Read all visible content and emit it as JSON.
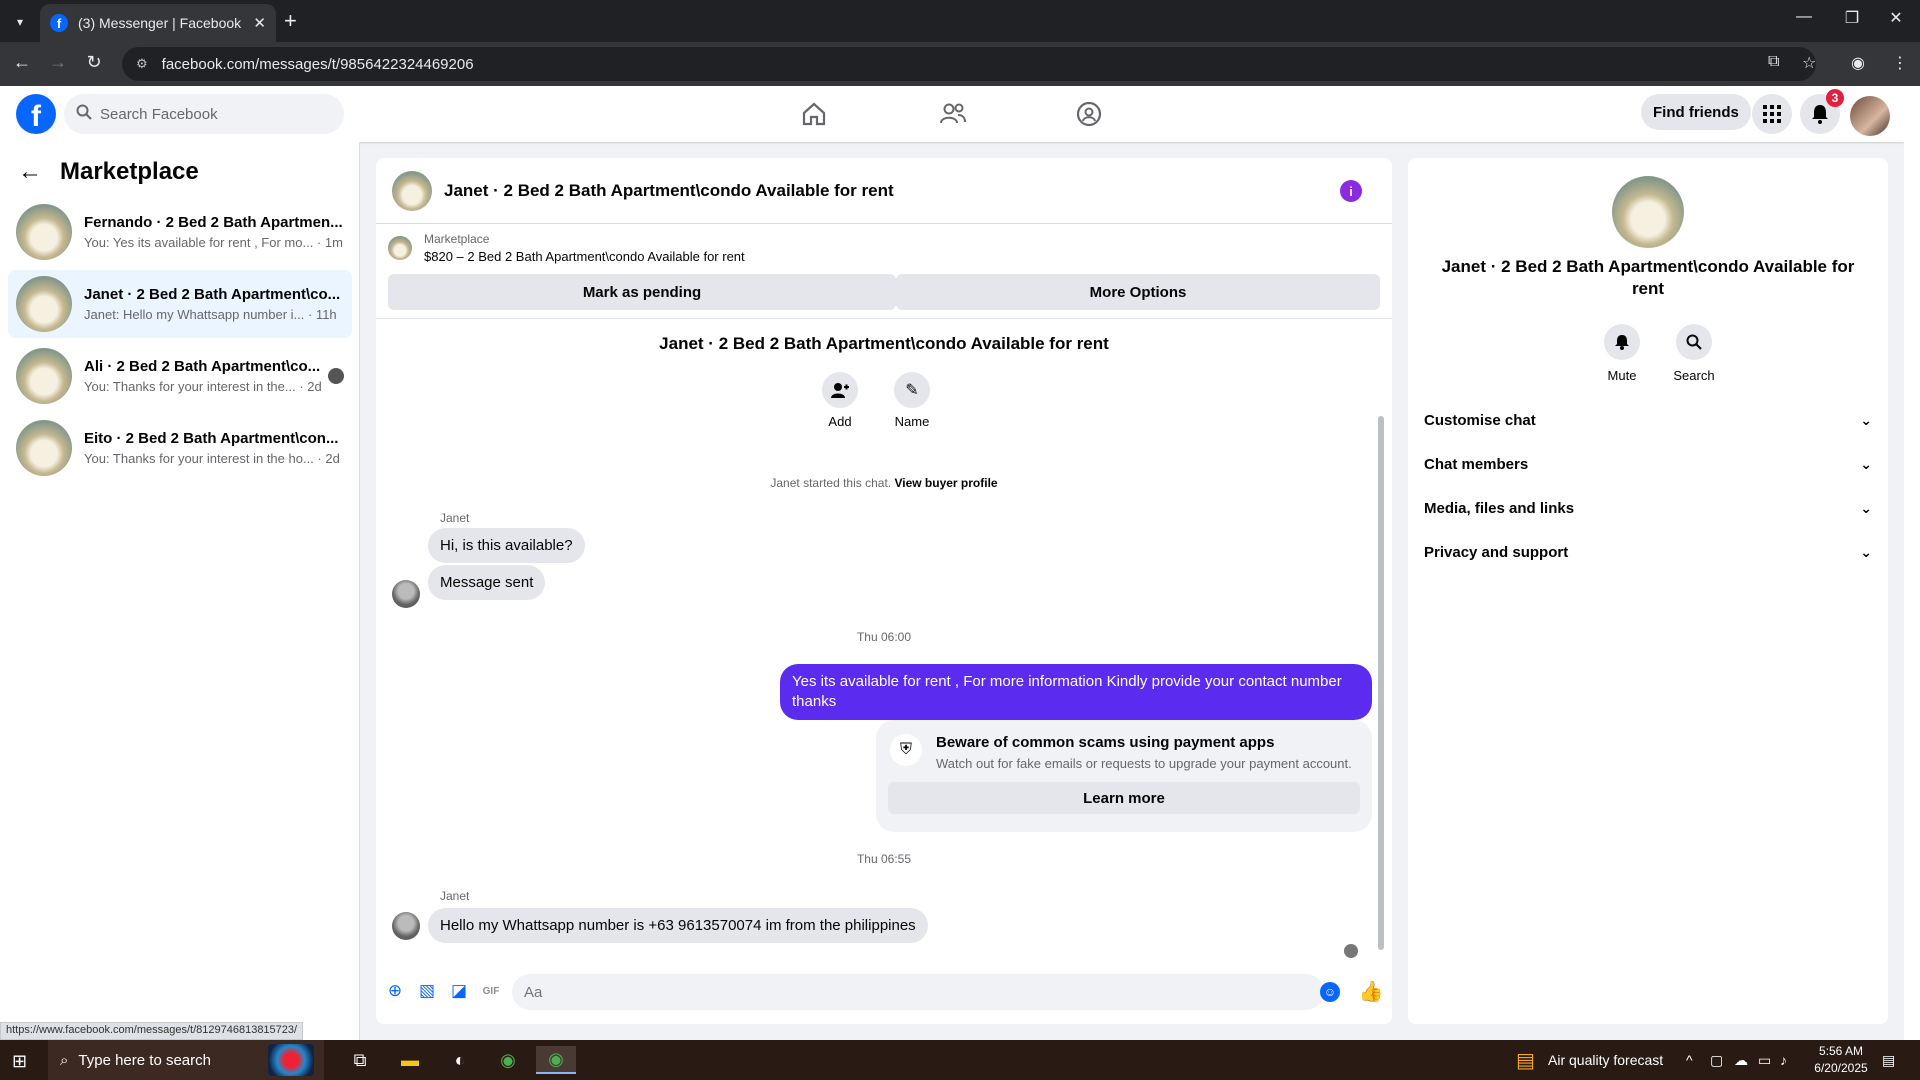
{
  "browser": {
    "tab_title": "(3) Messenger | Facebook",
    "url": "facebook.com/messages/t/9856422324469206",
    "status_url": "https://www.facebook.com/messages/t/8129746813815723/"
  },
  "fb": {
    "search_placeholder": "Search Facebook",
    "find_friends": "Find friends",
    "notification_count": "3",
    "brand_color": "#0866ff"
  },
  "sidebar": {
    "title": "Marketplace",
    "conversations": [
      {
        "name": "Fernando · 2 Bed 2 Bath Apartmen...",
        "snippet": "You: Yes its available for rent , For mo... · 1m",
        "active": false
      },
      {
        "name": "Janet · 2 Bed 2 Bath Apartment\\co...",
        "snippet": "Janet: Hello my Whattsapp number i... · 11h",
        "active": true
      },
      {
        "name": "Ali · 2 Bed 2 Bath Apartment\\co...",
        "snippet": "You: Thanks for your interest in the... · 2d",
        "active": false
      },
      {
        "name": "Eito · 2 Bed 2 Bath Apartment\\con...",
        "snippet": "You: Thanks for your interest in the ho... · 2d",
        "active": false
      }
    ]
  },
  "chat": {
    "title": "Janet · 2 Bed 2 Bath Apartment\\condo Available for rent",
    "marketplace_label": "Marketplace",
    "listing": "$820 – 2 Bed 2 Bath Apartment\\condo Available for rent",
    "mark_pending": "Mark as pending",
    "more_options": "More Options",
    "intro_name": "Janet · 2 Bed 2 Bath Apartment\\condo Available for rent",
    "add_label": "Add",
    "name_label": "Name",
    "started_text": "Janet started this chat.",
    "view_profile": "View buyer profile",
    "sender": "Janet",
    "msg1": "Hi, is this available?",
    "msg2": "Message sent",
    "time1": "Thu 06:00",
    "out_msg": "Yes its  available for rent , For more information Kindly provide your contact number thanks",
    "scam_title": "Beware of common scams using payment apps",
    "scam_desc": "Watch out for fake emails or requests to upgrade your payment account.",
    "learn_more": "Learn more",
    "time2": "Thu 06:55",
    "msg3": "Hello my Whattsapp number is +63 9613570074 im from the philippines",
    "composer_placeholder": "Aa",
    "outgoing_color": "#5b2bf0"
  },
  "details": {
    "title": "Janet · 2 Bed 2 Bath Apartment\\condo Available for rent",
    "mute": "Mute",
    "search": "Search",
    "rows": [
      "Customise chat",
      "Chat members",
      "Media, files and links",
      "Privacy and support"
    ]
  },
  "taskbar": {
    "search_placeholder": "Type here to search",
    "weather": "Air quality forecast",
    "time": "5:56 AM",
    "date": "6/20/2025"
  }
}
